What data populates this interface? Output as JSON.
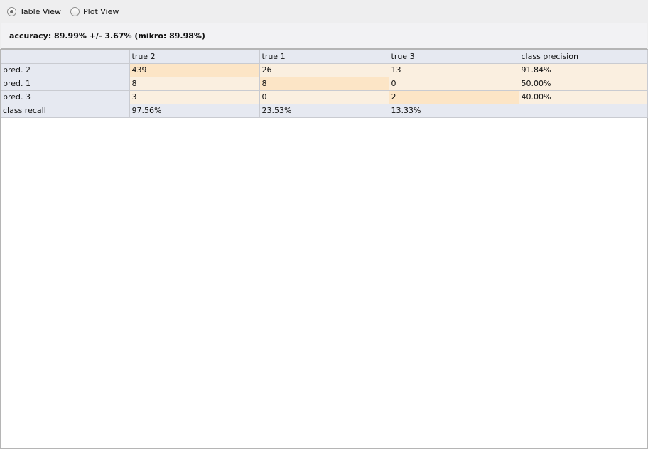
{
  "view_toggle": {
    "options": [
      {
        "label": "Table View",
        "selected": true
      },
      {
        "label": "Plot View",
        "selected": false
      }
    ]
  },
  "accuracy_text": "accuracy: 89.99% +/- 3.67% (mikro: 89.98%)",
  "table": {
    "columns": [
      "",
      "true 2",
      "true 1",
      "true 3",
      "class precision"
    ],
    "rows": [
      [
        "pred. 2",
        "439",
        "26",
        "13",
        "91.84%"
      ],
      [
        "pred. 1",
        "8",
        "8",
        "0",
        "50.00%"
      ],
      [
        "pred. 3",
        "3",
        "0",
        "2",
        "40.00%"
      ],
      [
        "class recall",
        "97.56%",
        "23.53%",
        "13.33%",
        ""
      ]
    ]
  },
  "colors": {
    "diagonal_cell": "#fce5c6",
    "off_diagonal_cell": "#faefe0",
    "header_cell": "#e6e9f1",
    "grid_line": "#c9cbd1"
  }
}
